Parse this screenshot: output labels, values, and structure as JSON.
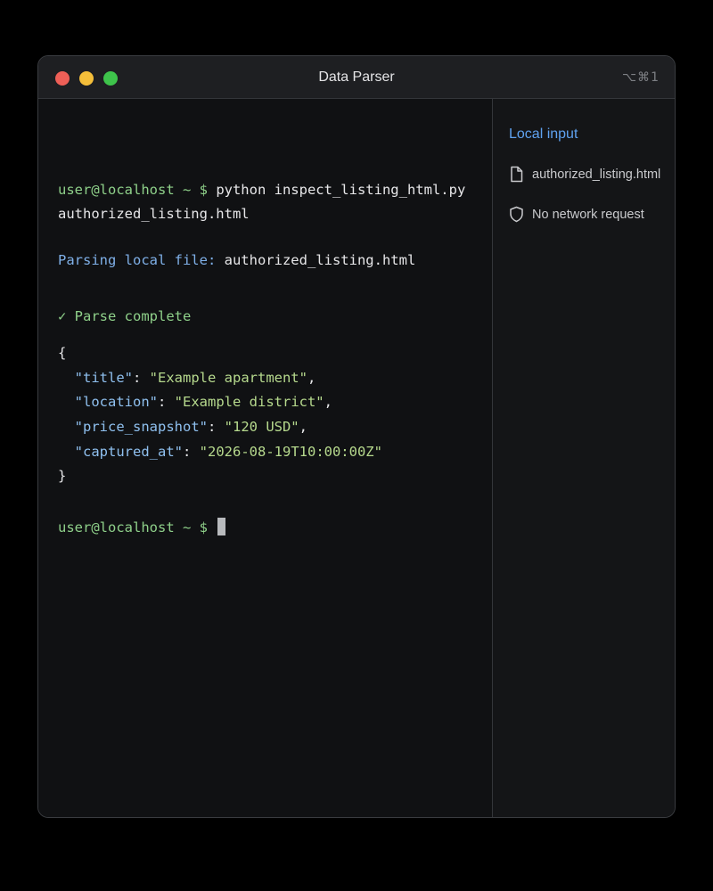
{
  "window": {
    "title": "Data Parser",
    "shortcut": "⌥⌘1"
  },
  "terminal": {
    "prompt": "user@localhost ~ $",
    "command": " python inspect_listing_html.py",
    "command_cont": "authorized_listing.html",
    "parsing_label": "Parsing local file:",
    "parsing_file": " authorized_listing.html",
    "complete": "✓ Parse complete",
    "json_open": "{",
    "json_close": "}",
    "fields": [
      {
        "key": "\"title\"",
        "value": "\"Example apartment\"",
        "trail": ","
      },
      {
        "key": "\"location\"",
        "value": "\"Example district\"",
        "trail": ","
      },
      {
        "key": "\"price_snapshot\"",
        "value": "\"120 USD\"",
        "trail": ","
      },
      {
        "key": "\"captured_at\"",
        "value": "\"2026-08-19T10:00:00Z\"",
        "trail": ""
      }
    ],
    "colon": ": "
  },
  "sidebar": {
    "heading": "Local input",
    "items": [
      {
        "icon": "file-icon",
        "label": "authorized_listing.html"
      },
      {
        "icon": "shield-icon",
        "label": "No network request"
      }
    ]
  },
  "colors": {
    "accent": "#5fa2f0",
    "prompt_green": "#8fd18a",
    "string_green": "#b6d98d",
    "key_blue": "#8fc0ef",
    "close": "#ee5f57",
    "minimize": "#f4be3a",
    "zoom": "#3ec34b"
  }
}
